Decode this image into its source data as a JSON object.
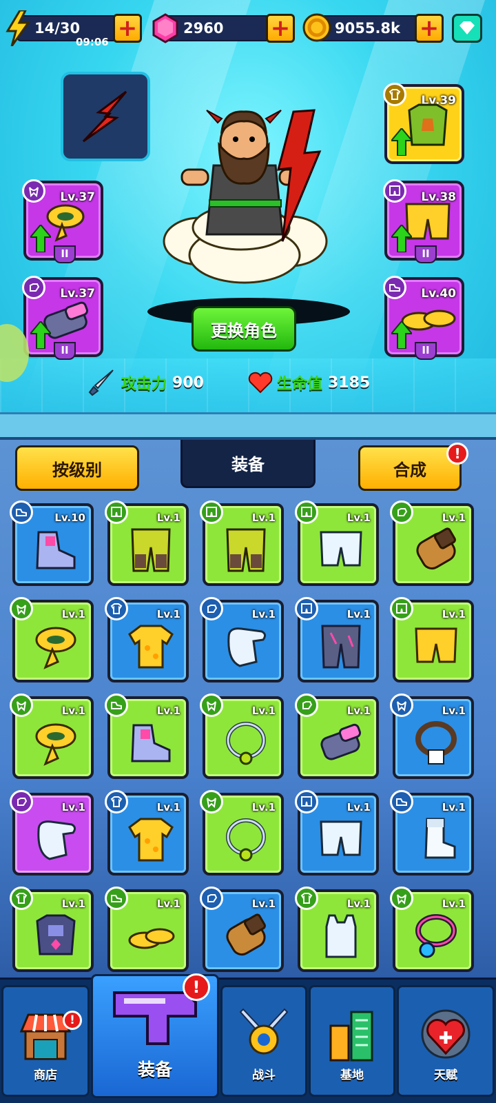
{
  "resources": {
    "energy": "14/30",
    "energy_timer": "09:06",
    "gems": "2960",
    "coins": "9055.8k"
  },
  "hero": {
    "change_character_label": "更换角色",
    "attack_label": "攻击力",
    "attack_value": "900",
    "hp_label": "生命值",
    "hp_value": "3185",
    "equipped": {
      "left_top": {
        "level": "Lv.37",
        "slot": "scarf-icon"
      },
      "left_bottom": {
        "level": "Lv.37",
        "slot": "glove-icon"
      },
      "right_top": {
        "level": "Lv.39",
        "slot": "shirt-icon"
      },
      "right_mid": {
        "level": "Lv.38",
        "slot": "shorts-icon"
      },
      "right_bottom": {
        "level": "Lv.40",
        "slot": "shoe-icon"
      }
    }
  },
  "inventory": {
    "sort_label": "按级别",
    "tab_label": "装备",
    "merge_label": "合成",
    "items": [
      {
        "level": "Lv.10",
        "rarity": "blue",
        "type": "shoe-icon",
        "item": "boot"
      },
      {
        "level": "Lv.1",
        "rarity": "green",
        "type": "shorts-icon",
        "item": "pants"
      },
      {
        "level": "Lv.1",
        "rarity": "green",
        "type": "shorts-icon",
        "item": "pants"
      },
      {
        "level": "Lv.1",
        "rarity": "green",
        "type": "shorts-icon",
        "item": "shorts-white"
      },
      {
        "level": "Lv.1",
        "rarity": "green",
        "type": "glove-icon",
        "item": "glove-brown"
      },
      {
        "level": "Lv.1",
        "rarity": "green",
        "type": "scarf-icon",
        "item": "scarf"
      },
      {
        "level": "Lv.1",
        "rarity": "blue",
        "type": "shirt-icon",
        "item": "shirt"
      },
      {
        "level": "Lv.1",
        "rarity": "blue",
        "type": "glove-icon",
        "item": "glove-white"
      },
      {
        "level": "Lv.1",
        "rarity": "blue",
        "type": "shorts-icon",
        "item": "pants-dark"
      },
      {
        "level": "Lv.1",
        "rarity": "green",
        "type": "shorts-icon",
        "item": "shorts-yellow"
      },
      {
        "level": "Lv.1",
        "rarity": "green",
        "type": "scarf-icon",
        "item": "scarf"
      },
      {
        "level": "Lv.1",
        "rarity": "green",
        "type": "shoe-icon",
        "item": "boot"
      },
      {
        "level": "Lv.1",
        "rarity": "green",
        "type": "scarf-icon",
        "item": "necklace"
      },
      {
        "level": "Lv.1",
        "rarity": "green",
        "type": "glove-icon",
        "item": "glove-tech"
      },
      {
        "level": "Lv.1",
        "rarity": "blue",
        "type": "scarf-icon",
        "item": "necklace-tag"
      },
      {
        "level": "Lv.1",
        "rarity": "purple",
        "type": "glove-icon",
        "item": "glove-white"
      },
      {
        "level": "Lv.1",
        "rarity": "blue",
        "type": "shirt-icon",
        "item": "shirt"
      },
      {
        "level": "Lv.1",
        "rarity": "green",
        "type": "scarf-icon",
        "item": "necklace"
      },
      {
        "level": "Lv.1",
        "rarity": "blue",
        "type": "shorts-icon",
        "item": "shorts-white"
      },
      {
        "level": "Lv.1",
        "rarity": "blue",
        "type": "shoe-icon",
        "item": "sock"
      },
      {
        "level": "Lv.1",
        "rarity": "green",
        "type": "shirt-icon",
        "item": "armor"
      },
      {
        "level": "Lv.1",
        "rarity": "green",
        "type": "shoe-icon",
        "item": "sandal"
      },
      {
        "level": "Lv.1",
        "rarity": "blue",
        "type": "glove-icon",
        "item": "glove-brown"
      },
      {
        "level": "Lv.1",
        "rarity": "green",
        "type": "shirt-icon",
        "item": "tank"
      },
      {
        "level": "Lv.1",
        "rarity": "green",
        "type": "scarf-icon",
        "item": "necklace-pendant"
      }
    ]
  },
  "nav": {
    "shop": "商店",
    "equipment": "装备",
    "battle": "战斗",
    "base": "基地",
    "talent": "天赋"
  },
  "colors": {
    "green_rarity": "#8fe63a",
    "blue_rarity": "#2b8fe6",
    "purple_rarity": "#c94cf0",
    "accent_yellow": "#ffc21a",
    "alert_red": "#e61a1a"
  }
}
